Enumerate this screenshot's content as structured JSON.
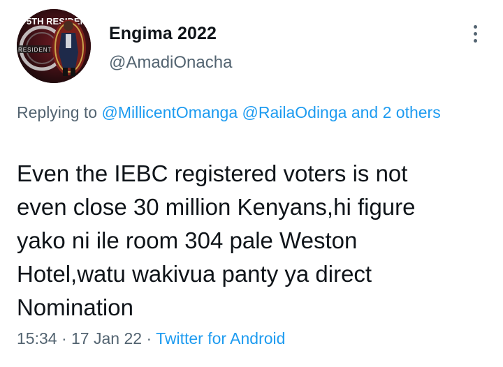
{
  "author": {
    "display_name": "Engima 2022",
    "handle": "@AmadiOnacha",
    "avatar_icon": "profile-photo",
    "avatar_text": "5TH RESIDENT"
  },
  "more_icon": "more-vertical-icon",
  "reply_context": {
    "prefix": "Replying to",
    "mention_1": "@MillicentOmanga",
    "mention_2": "@RailaOdinga",
    "others": "and 2 others"
  },
  "tweet": {
    "line_1": "Even the IEBC registered voters is not",
    "line_2": "even close 30 million Kenyans,hi figure",
    "line_3": "yako ni ile room 304 pale Weston",
    "line_4": "Hotel,watu wakivua panty ya direct",
    "line_5": "Nomination"
  },
  "meta": {
    "time": "15:34",
    "separator": "·",
    "date": "17 Jan 22",
    "source": "Twitter for Android"
  },
  "colors": {
    "link": "#1d9bf0",
    "secondary_text": "#536471",
    "primary_text": "#0f1419"
  }
}
